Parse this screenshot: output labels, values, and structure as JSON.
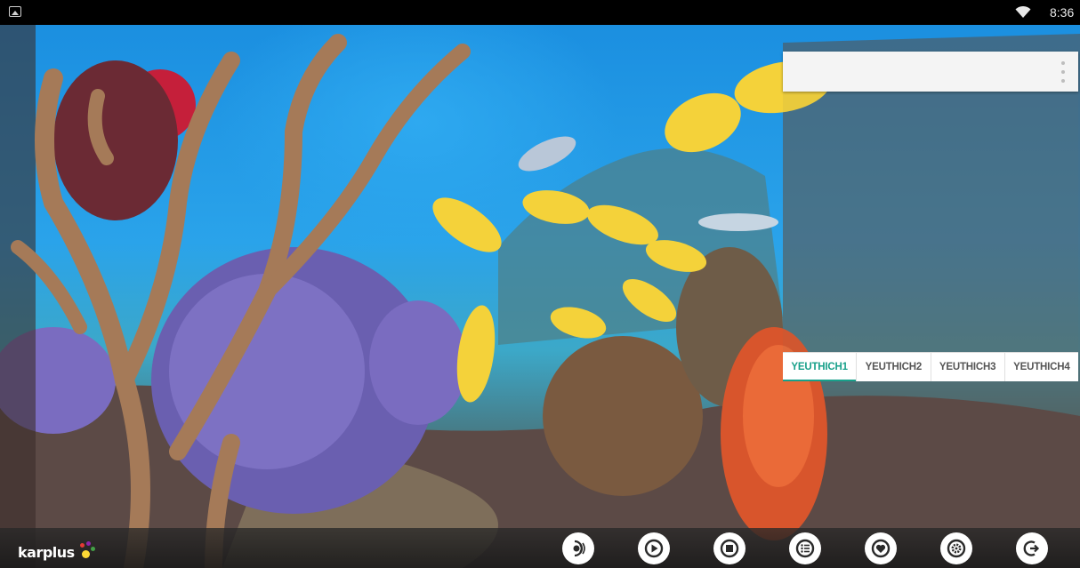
{
  "status_bar": {
    "time": "8:36",
    "icons": [
      "image-notification-icon",
      "wifi-icon"
    ]
  },
  "panel": {
    "menu_icon": "overflow-menu-icon",
    "tabs": [
      {
        "label": "YEUTHICH1",
        "active": true
      },
      {
        "label": "YEUTHICH2",
        "active": false
      },
      {
        "label": "YEUTHICH3",
        "active": false
      },
      {
        "label": "YEUTHICH4",
        "active": false
      }
    ]
  },
  "bottom_bar": {
    "logo_text": "karplus",
    "controls": [
      "voice-icon",
      "play-icon",
      "stop-icon",
      "playlist-icon",
      "favorite-icon",
      "settings-icon",
      "exit-icon"
    ]
  },
  "colors": {
    "active_tab": "#18a08a",
    "control_dark": "#2a2a2a"
  }
}
